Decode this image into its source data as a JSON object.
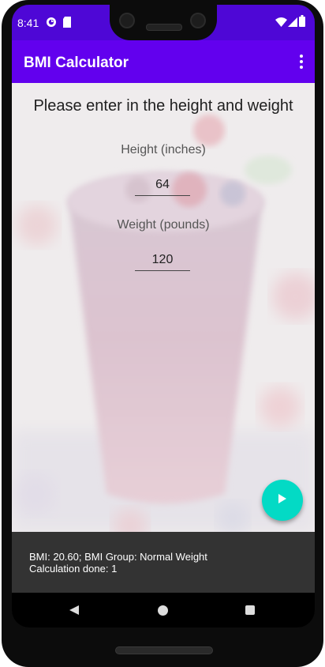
{
  "status_bar": {
    "time": "8:41",
    "icons": [
      "sync-icon",
      "sd-card-icon",
      "wifi-icon",
      "signal-icon",
      "battery-icon"
    ]
  },
  "app_bar": {
    "title": "BMI Calculator",
    "menu_icon": "more-vert-icon"
  },
  "form": {
    "prompt": "Please enter in the height and weight",
    "height_label": "Height (inches)",
    "height_value": "64",
    "weight_label": "Weight (pounds)",
    "weight_value": "120"
  },
  "fab": {
    "icon": "play-icon",
    "color": "#03dac5"
  },
  "result": {
    "line1": "BMI: 20.60; BMI Group: Normal Weight",
    "line2": "Calculation done: 1"
  },
  "nav": {
    "icons": [
      "back-icon",
      "home-icon",
      "recents-icon"
    ]
  },
  "colors": {
    "status_bar": "#4e07d6",
    "app_bar": "#6200ee",
    "accent": "#03dac5",
    "result_panel": "#333333"
  }
}
